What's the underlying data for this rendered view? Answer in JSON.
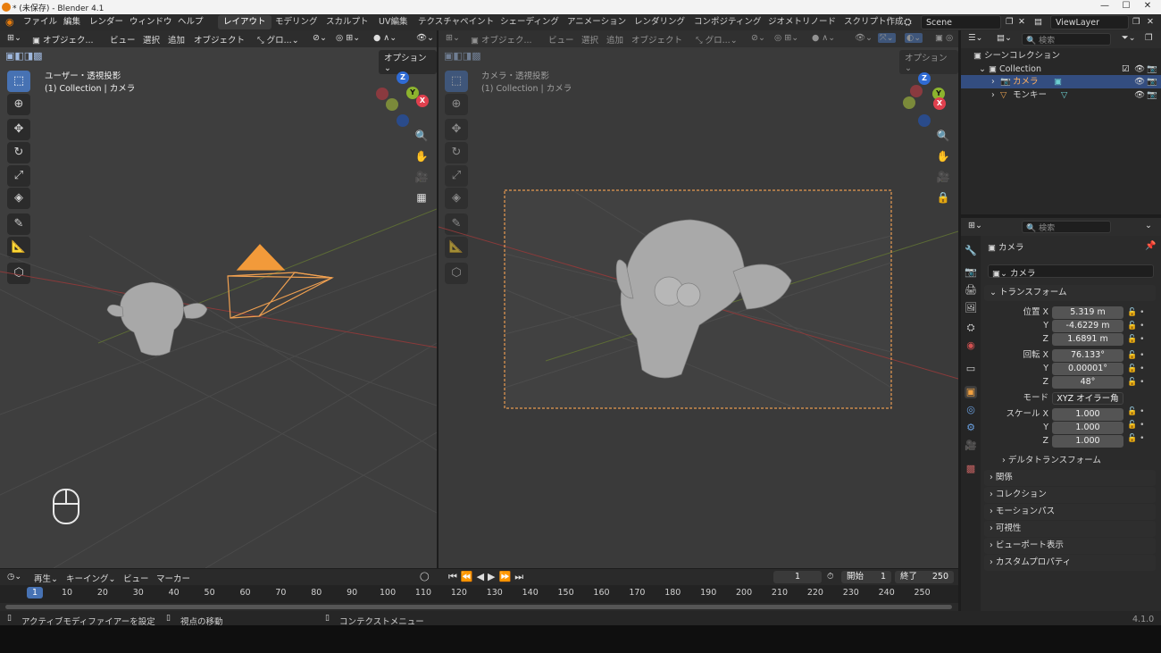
{
  "window": {
    "title": "* (未保存) - Blender 4.1"
  },
  "menu": {
    "file": "ファイル",
    "edit": "編集",
    "render": "レンダー",
    "window": "ウィンドウ",
    "help": "ヘルプ"
  },
  "workspaces": [
    "レイアウト",
    "モデリング",
    "スカルプト",
    "UV編集",
    "テクスチャペイント",
    "シェーディング",
    "アニメーション",
    "レンダリング",
    "コンポジティング",
    "ジオメトリノード",
    "スクリプト作成"
  ],
  "scene": {
    "name": "Scene",
    "view_layer": "ViewLayer"
  },
  "viewport_left": {
    "mode": "オブジェク...",
    "menus": [
      "ビュー",
      "選択",
      "追加",
      "オブジェクト"
    ],
    "orientation": "グロ...",
    "options": "オプション",
    "title": "ユーザー・透視投影",
    "subtitle": "(1) Collection | カメラ"
  },
  "viewport_right": {
    "mode": "オブジェク...",
    "menus": [
      "ビュー",
      "選択",
      "追加",
      "オブジェクト"
    ],
    "orientation": "グロ...",
    "options": "オプション",
    "title": "カメラ・透視投影",
    "subtitle": "(1) Collection | カメラ"
  },
  "gizmo": {
    "x": "X",
    "y": "Y",
    "z": "Z"
  },
  "outliner": {
    "search_placeholder": "検索",
    "scene_collection": "シーンコレクション",
    "collection": "Collection",
    "items": [
      "カメラ",
      "モンキー"
    ]
  },
  "properties": {
    "search_placeholder": "検索",
    "object_name": "カメラ",
    "object_field": "カメラ",
    "transform_header": "トランスフォーム",
    "location_label": "位置 X",
    "rotation_label": "回転 X",
    "y_label": "Y",
    "z_label": "Z",
    "location": [
      "5.319 m",
      "-4.6229 m",
      "1.6891 m"
    ],
    "rotation": [
      "76.133°",
      "0.00001°",
      "48°"
    ],
    "mode_label": "モード",
    "mode_value": "XYZ オイラー角",
    "scale_label": "スケール X",
    "scale": [
      "1.000",
      "1.000",
      "1.000"
    ],
    "delta_transform": "デルタトランスフォーム",
    "panels": [
      "関係",
      "コレクション",
      "モーションパス",
      "可視性",
      "ビューポート表示",
      "カスタムプロパティ"
    ]
  },
  "timeline": {
    "menus": [
      "再生",
      "キーイング",
      "ビュー",
      "マーカー"
    ],
    "current_frame": "1",
    "start_label": "開始",
    "start": "1",
    "end_label": "終了",
    "end": "250",
    "ticks": [
      "1",
      "10",
      "20",
      "30",
      "40",
      "50",
      "60",
      "70",
      "80",
      "90",
      "100",
      "110",
      "120",
      "130",
      "140",
      "150",
      "160",
      "170",
      "180",
      "190",
      "200",
      "210",
      "220",
      "230",
      "240",
      "250"
    ]
  },
  "statusbar": {
    "hint1": "アクティブモディファイアーを設定",
    "hint2": "視点の移動",
    "hint3": "コンテクストメニュー",
    "version": "4.1.0"
  }
}
